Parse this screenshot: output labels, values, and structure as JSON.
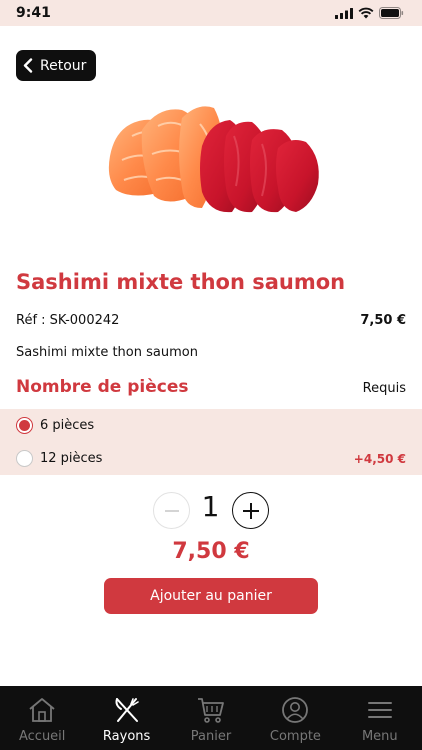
{
  "status_bar": {
    "time": "9:41"
  },
  "nav": {
    "back_label": "Retour"
  },
  "product": {
    "title": "Sashimi mixte thon saumon",
    "reference": "Réf : SK-000242",
    "price": "7,50 €",
    "description": "Sashimi mixte thon saumon"
  },
  "pieces": {
    "title": "Nombre de pièces",
    "requirement": "Requis",
    "options": [
      {
        "label": "6 pièces",
        "extra": "",
        "selected": true
      },
      {
        "label": "12 pièces",
        "extra": "+4,50 €",
        "selected": false
      }
    ]
  },
  "quantity": {
    "value": "1"
  },
  "total": "7,50 €",
  "add_button_label": "Ajouter au panier",
  "tabs": [
    {
      "label": "Accueil",
      "icon": "home-icon",
      "active": false
    },
    {
      "label": "Rayons",
      "icon": "fork-knife-icon",
      "active": true
    },
    {
      "label": "Panier",
      "icon": "cart-icon",
      "active": false
    },
    {
      "label": "Compte",
      "icon": "user-icon",
      "active": false
    },
    {
      "label": "Menu",
      "icon": "menu-icon",
      "active": false
    }
  ],
  "colors": {
    "accent": "#d0393f",
    "header_bg": "#f7e7e2",
    "tabbar_bg": "#0f0f0f"
  }
}
